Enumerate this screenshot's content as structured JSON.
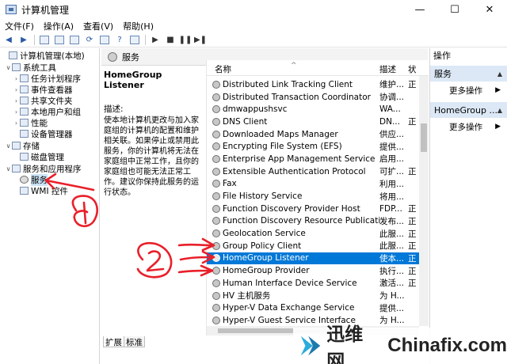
{
  "window": {
    "title": "计算机管理",
    "minimize": "—",
    "maximize": "☐",
    "close": "✕"
  },
  "menu": [
    "文件(F)",
    "操作(A)",
    "查看(V)",
    "帮助(H)"
  ],
  "tree": [
    {
      "label": "计算机管理(本地)",
      "level": 0,
      "arrow": "",
      "selected": false
    },
    {
      "label": "系统工具",
      "level": 1,
      "arrow": "∨",
      "selected": false
    },
    {
      "label": "任务计划程序",
      "level": 2,
      "arrow": "›",
      "selected": false
    },
    {
      "label": "事件查看器",
      "level": 2,
      "arrow": "›",
      "selected": false
    },
    {
      "label": "共享文件夹",
      "level": 2,
      "arrow": "›",
      "selected": false
    },
    {
      "label": "本地用户和组",
      "level": 2,
      "arrow": "›",
      "selected": false
    },
    {
      "label": "性能",
      "level": 2,
      "arrow": "›",
      "selected": false
    },
    {
      "label": "设备管理器",
      "level": 2,
      "arrow": "",
      "selected": false
    },
    {
      "label": "存储",
      "level": 1,
      "arrow": "∨",
      "selected": false
    },
    {
      "label": "磁盘管理",
      "level": 2,
      "arrow": "",
      "selected": false
    },
    {
      "label": "服务和应用程序",
      "level": 1,
      "arrow": "∨",
      "selected": false
    },
    {
      "label": "服务",
      "level": 2,
      "arrow": "",
      "selected": true
    },
    {
      "label": "WMI 控件",
      "level": 2,
      "arrow": "",
      "selected": false
    }
  ],
  "middle": {
    "header": "服务",
    "selected_service": "HomeGroup Listener",
    "desc_label": "描述:",
    "desc_text": "使本地计算机更改与加入家庭组的计算机的配置和维护相关联。如果停止或禁用此服务，你的计算机将无法在家庭组中正常工作，且你的家庭组也可能无法正常工作。建议你保持此服务的运行状态。"
  },
  "columns": {
    "name": "名称",
    "desc": "描述",
    "status": "状"
  },
  "services": [
    {
      "name": "Distributed Link Tracking Client",
      "desc": "维护...",
      "status": "正",
      "selected": false
    },
    {
      "name": "Distributed Transaction Coordinator",
      "desc": "协调...",
      "status": "",
      "selected": false
    },
    {
      "name": "dmwappushsvc",
      "desc": "WA...",
      "status": "",
      "selected": false
    },
    {
      "name": "DNS Client",
      "desc": "DN...",
      "status": "正",
      "selected": false
    },
    {
      "name": "Downloaded Maps Manager",
      "desc": "供应...",
      "status": "",
      "selected": false
    },
    {
      "name": "Encrypting File System (EFS)",
      "desc": "提供...",
      "status": "",
      "selected": false
    },
    {
      "name": "Enterprise App Management Service",
      "desc": "启用...",
      "status": "",
      "selected": false
    },
    {
      "name": "Extensible Authentication Protocol",
      "desc": "可扩...",
      "status": "正",
      "selected": false
    },
    {
      "name": "Fax",
      "desc": "利用...",
      "status": "",
      "selected": false
    },
    {
      "name": "File History Service",
      "desc": "将用...",
      "status": "",
      "selected": false
    },
    {
      "name": "Function Discovery Provider Host",
      "desc": "FDP...",
      "status": "正",
      "selected": false
    },
    {
      "name": "Function Discovery Resource Publication",
      "desc": "发布...",
      "status": "正",
      "selected": false
    },
    {
      "name": "Geolocation Service",
      "desc": "此服...",
      "status": "正",
      "selected": false
    },
    {
      "name": "Group Policy Client",
      "desc": "此服...",
      "status": "正",
      "selected": false
    },
    {
      "name": "HomeGroup Listener",
      "desc": "使本...",
      "status": "正",
      "selected": true
    },
    {
      "name": "HomeGroup Provider",
      "desc": "执行...",
      "status": "正",
      "selected": false
    },
    {
      "name": "Human Interface Device Service",
      "desc": "激活...",
      "status": "正",
      "selected": false
    },
    {
      "name": "HV 主机服务",
      "desc": "为 H...",
      "status": "",
      "selected": false
    },
    {
      "name": "Hyper-V Data Exchange Service",
      "desc": "提供...",
      "status": "",
      "selected": false
    },
    {
      "name": "Hyper-V Guest Service Interface",
      "desc": "为 H...",
      "status": "",
      "selected": false
    }
  ],
  "tabs": [
    "扩展",
    "标准"
  ],
  "actions": {
    "header": "操作",
    "section1": "服务",
    "more1": "更多操作",
    "section2": "HomeGroup ...",
    "more2": "更多操作"
  },
  "annotations": [
    "①",
    "②"
  ],
  "watermark": {
    "cn": "迅维网",
    "en": "Chinafix.com"
  },
  "colors": {
    "selection": "#0078d7",
    "annotation": "#e8202a",
    "section_bg": "#dce8f6"
  }
}
